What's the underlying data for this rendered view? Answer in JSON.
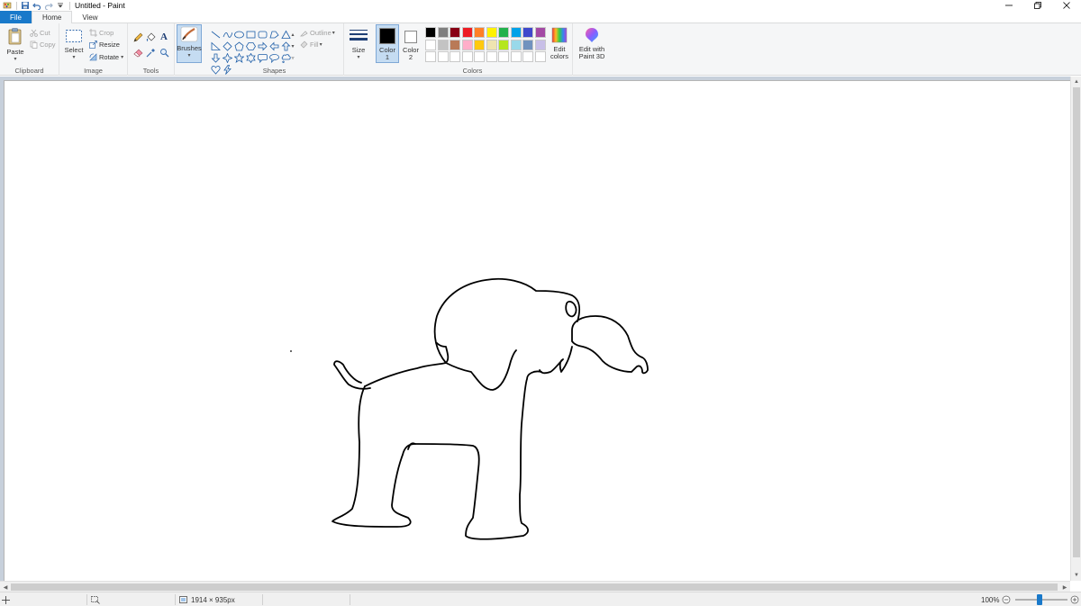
{
  "window": {
    "title": "Untitled - Paint"
  },
  "tabs": [
    {
      "label": "File"
    },
    {
      "label": "Home"
    },
    {
      "label": "View"
    }
  ],
  "ribbon": {
    "clipboard": {
      "group_label": "Clipboard",
      "paste_label": "Paste",
      "cut_label": "Cut",
      "copy_label": "Copy"
    },
    "image": {
      "group_label": "Image",
      "select_label": "Select",
      "crop_label": "Crop",
      "resize_label": "Resize",
      "rotate_label": "Rotate"
    },
    "tools": {
      "group_label": "Tools",
      "text_tool_glyph": "A"
    },
    "brushes": {
      "label": "Brushes"
    },
    "shapes": {
      "group_label": "Shapes",
      "outline_label": "Outline",
      "fill_label": "Fill"
    },
    "size": {
      "label": "Size"
    },
    "colors": {
      "group_label": "Colors",
      "color1_label": "Color",
      "color1_num": "1",
      "color2_label": "Color",
      "color2_num": "2",
      "color1_value": "#000000",
      "color2_value": "#ffffff",
      "edit_colors_label_1": "Edit",
      "edit_colors_label_2": "colors",
      "palette_row1": [
        "#000000",
        "#7f7f7f",
        "#880015",
        "#ed1c24",
        "#ff7f27",
        "#fff200",
        "#22b14c",
        "#00a2e8",
        "#3f48cc",
        "#a349a4"
      ],
      "palette_row2": [
        "#ffffff",
        "#c3c3c3",
        "#b97a57",
        "#ffaec9",
        "#ffc90e",
        "#efe4b0",
        "#b5e61d",
        "#99d9ea",
        "#7092be",
        "#c8bfe7"
      ],
      "palette_row3": [
        "#ffffff",
        "#ffffff",
        "#ffffff",
        "#ffffff",
        "#ffffff",
        "#ffffff",
        "#ffffff",
        "#ffffff",
        "#ffffff",
        "#ffffff"
      ]
    },
    "paint3d": {
      "label_1": "Edit with",
      "label_2": "Paint 3D"
    }
  },
  "statusbar": {
    "canvas_size": "1914 × 935px",
    "zoom": "100%",
    "zoom_fraction": 0.5
  },
  "canvas": {
    "drawing": "elephant outline sketch"
  }
}
